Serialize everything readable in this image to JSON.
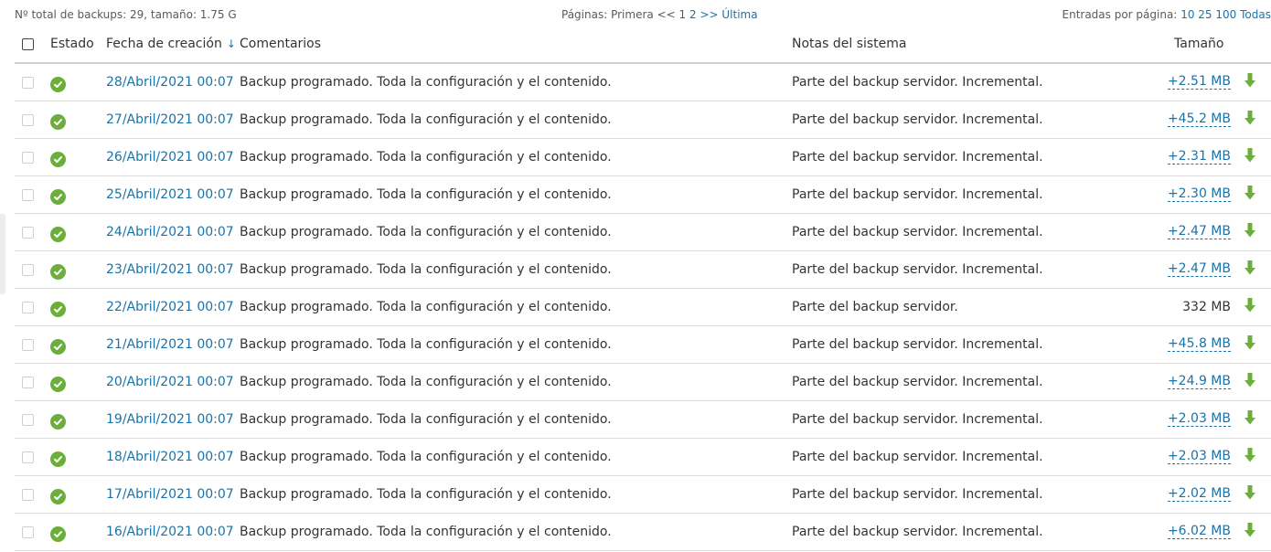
{
  "topbar": {
    "summary": "Nº total de backups: 29, tamaño: 1.75 G",
    "pager_label": "Páginas:",
    "pager_first": "Primera",
    "pager_prev": "<<",
    "pager_current": "1",
    "pager_page2": "2",
    "pager_next": ">>",
    "pager_last": "Última",
    "perpage_label": "Entradas por página:",
    "perpage_10": "10",
    "perpage_25": "25",
    "perpage_100": "100",
    "perpage_all": "Todas"
  },
  "columns": {
    "status": "Estado",
    "date": "Fecha de creación",
    "sort_arrow": "↓",
    "comments": "Comentarios",
    "notes": "Notas del sistema",
    "size": "Tamaño"
  },
  "colors": {
    "link": "#1a73a8",
    "status_ok": "#6cae3b",
    "download": "#6cae3b"
  },
  "rows": [
    {
      "date": "28/Abril/2021 00:07",
      "comment": "Backup programado. Toda la configuración y el contenido.",
      "notes": "Parte del backup servidor. Incremental.",
      "size": "+2.51 MB",
      "incremental": true
    },
    {
      "date": "27/Abril/2021 00:07",
      "comment": "Backup programado. Toda la configuración y el contenido.",
      "notes": "Parte del backup servidor. Incremental.",
      "size": "+45.2 MB",
      "incremental": true
    },
    {
      "date": "26/Abril/2021 00:07",
      "comment": "Backup programado. Toda la configuración y el contenido.",
      "notes": "Parte del backup servidor. Incremental.",
      "size": "+2.31 MB",
      "incremental": true
    },
    {
      "date": "25/Abril/2021 00:07",
      "comment": "Backup programado. Toda la configuración y el contenido.",
      "notes": "Parte del backup servidor. Incremental.",
      "size": "+2.30 MB",
      "incremental": true
    },
    {
      "date": "24/Abril/2021 00:07",
      "comment": "Backup programado. Toda la configuración y el contenido.",
      "notes": "Parte del backup servidor. Incremental.",
      "size": "+2.47 MB",
      "incremental": true
    },
    {
      "date": "23/Abril/2021 00:07",
      "comment": "Backup programado. Toda la configuración y el contenido.",
      "notes": "Parte del backup servidor. Incremental.",
      "size": "+2.47 MB",
      "incremental": true
    },
    {
      "date": "22/Abril/2021 00:07",
      "comment": "Backup programado. Toda la configuración y el contenido.",
      "notes": "Parte del backup servidor.",
      "size": "332 MB",
      "incremental": false
    },
    {
      "date": "21/Abril/2021 00:07",
      "comment": "Backup programado. Toda la configuración y el contenido.",
      "notes": "Parte del backup servidor. Incremental.",
      "size": "+45.8 MB",
      "incremental": true
    },
    {
      "date": "20/Abril/2021 00:07",
      "comment": "Backup programado. Toda la configuración y el contenido.",
      "notes": "Parte del backup servidor. Incremental.",
      "size": "+24.9 MB",
      "incremental": true
    },
    {
      "date": "19/Abril/2021 00:07",
      "comment": "Backup programado. Toda la configuración y el contenido.",
      "notes": "Parte del backup servidor. Incremental.",
      "size": "+2.03 MB",
      "incremental": true
    },
    {
      "date": "18/Abril/2021 00:07",
      "comment": "Backup programado. Toda la configuración y el contenido.",
      "notes": "Parte del backup servidor. Incremental.",
      "size": "+2.03 MB",
      "incremental": true
    },
    {
      "date": "17/Abril/2021 00:07",
      "comment": "Backup programado. Toda la configuración y el contenido.",
      "notes": "Parte del backup servidor. Incremental.",
      "size": "+2.02 MB",
      "incremental": true
    },
    {
      "date": "16/Abril/2021 00:07",
      "comment": "Backup programado. Toda la configuración y el contenido.",
      "notes": "Parte del backup servidor. Incremental.",
      "size": "+6.02 MB",
      "incremental": true
    }
  ]
}
